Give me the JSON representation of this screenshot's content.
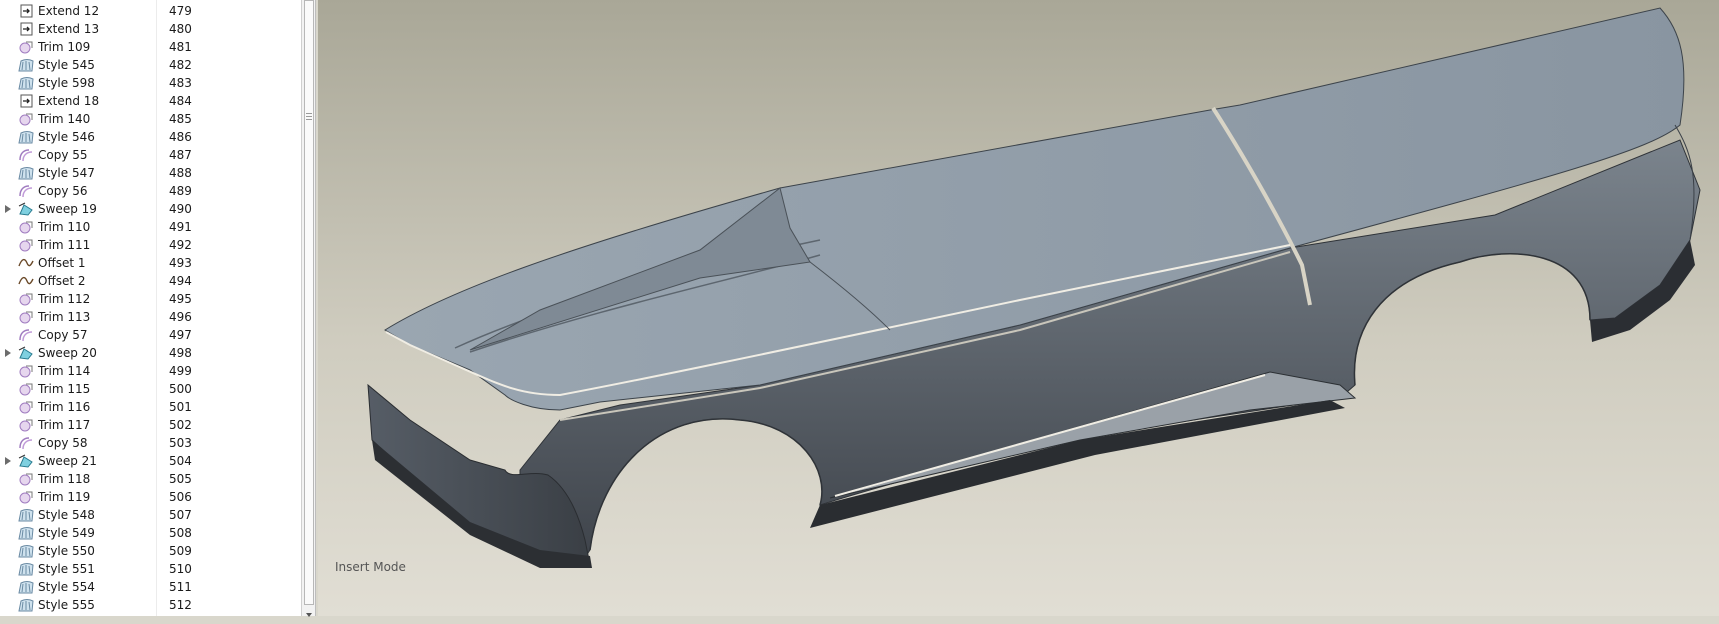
{
  "model_tree": {
    "rows": [
      {
        "icon": "extend-icon",
        "name": "Extend 12",
        "id": "479",
        "expandable": false
      },
      {
        "icon": "extend-icon",
        "name": "Extend 13",
        "id": "480",
        "expandable": false
      },
      {
        "icon": "trim-icon",
        "name": "Trim 109",
        "id": "481",
        "expandable": false
      },
      {
        "icon": "style-icon",
        "name": "Style 545",
        "id": "482",
        "expandable": false
      },
      {
        "icon": "style-icon",
        "name": "Style 598",
        "id": "483",
        "expandable": false
      },
      {
        "icon": "extend-icon",
        "name": "Extend 18",
        "id": "484",
        "expandable": false
      },
      {
        "icon": "trim-icon",
        "name": "Trim 140",
        "id": "485",
        "expandable": false
      },
      {
        "icon": "style-icon",
        "name": "Style 546",
        "id": "486",
        "expandable": false
      },
      {
        "icon": "copy-icon",
        "name": "Copy 55",
        "id": "487",
        "expandable": false
      },
      {
        "icon": "style-icon",
        "name": "Style 547",
        "id": "488",
        "expandable": false
      },
      {
        "icon": "copy-icon",
        "name": "Copy 56",
        "id": "489",
        "expandable": false
      },
      {
        "icon": "sweep-icon",
        "name": "Sweep 19",
        "id": "490",
        "expandable": true
      },
      {
        "icon": "trim-icon",
        "name": "Trim 110",
        "id": "491",
        "expandable": false
      },
      {
        "icon": "trim-icon",
        "name": "Trim 111",
        "id": "492",
        "expandable": false
      },
      {
        "icon": "offset-icon",
        "name": "Offset 1",
        "id": "493",
        "expandable": false
      },
      {
        "icon": "offset-icon",
        "name": "Offset 2",
        "id": "494",
        "expandable": false
      },
      {
        "icon": "trim-icon",
        "name": "Trim 112",
        "id": "495",
        "expandable": false
      },
      {
        "icon": "trim-icon",
        "name": "Trim 113",
        "id": "496",
        "expandable": false
      },
      {
        "icon": "copy-icon",
        "name": "Copy 57",
        "id": "497",
        "expandable": false
      },
      {
        "icon": "sweep-icon",
        "name": "Sweep 20",
        "id": "498",
        "expandable": true
      },
      {
        "icon": "trim-icon",
        "name": "Trim 114",
        "id": "499",
        "expandable": false
      },
      {
        "icon": "trim-icon",
        "name": "Trim 115",
        "id": "500",
        "expandable": false
      },
      {
        "icon": "trim-icon",
        "name": "Trim 116",
        "id": "501",
        "expandable": false
      },
      {
        "icon": "trim-icon",
        "name": "Trim 117",
        "id": "502",
        "expandable": false
      },
      {
        "icon": "copy-icon",
        "name": "Copy 58",
        "id": "503",
        "expandable": false
      },
      {
        "icon": "sweep-icon",
        "name": "Sweep 21",
        "id": "504",
        "expandable": true
      },
      {
        "icon": "trim-icon",
        "name": "Trim 118",
        "id": "505",
        "expandable": false
      },
      {
        "icon": "trim-icon",
        "name": "Trim 119",
        "id": "506",
        "expandable": false
      },
      {
        "icon": "style-icon",
        "name": "Style 548",
        "id": "507",
        "expandable": false
      },
      {
        "icon": "style-icon",
        "name": "Style 549",
        "id": "508",
        "expandable": false
      },
      {
        "icon": "style-icon",
        "name": "Style 550",
        "id": "509",
        "expandable": false
      },
      {
        "icon": "style-icon",
        "name": "Style 551",
        "id": "510",
        "expandable": false
      },
      {
        "icon": "style-icon",
        "name": "Style 554",
        "id": "511",
        "expandable": false
      },
      {
        "icon": "style-icon",
        "name": "Style 555",
        "id": "512",
        "expandable": false
      }
    ]
  },
  "viewport": {
    "status_text": "Insert Mode",
    "background_top": "#a8a696",
    "background_bottom": "#e0ddd2",
    "surface_color": "#8d98a3",
    "shadow_color": "#3d4147"
  }
}
